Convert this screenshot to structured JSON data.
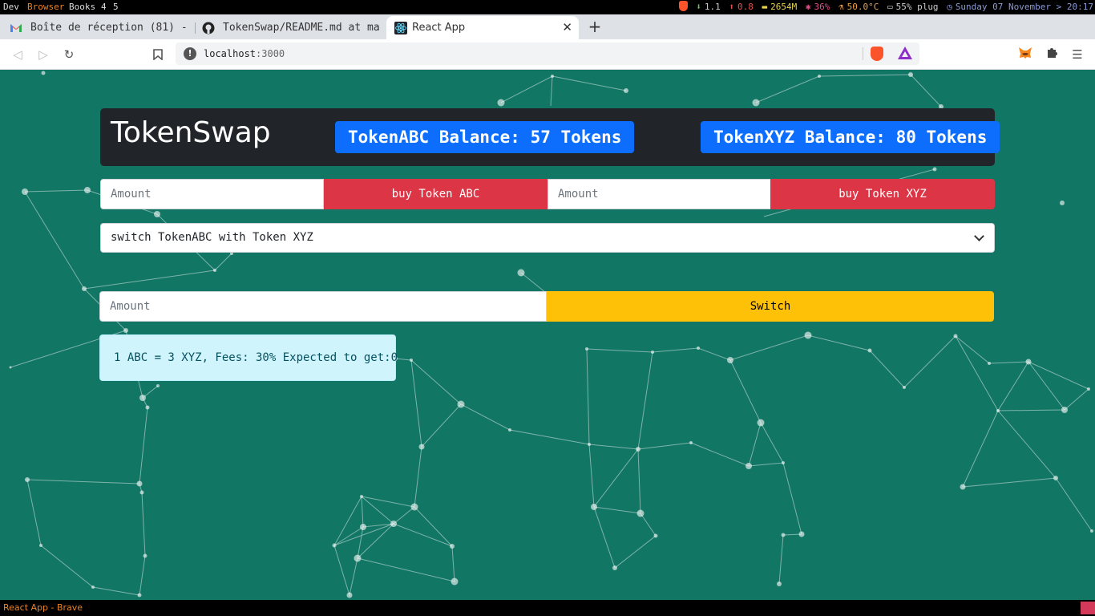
{
  "system_bar": {
    "workspaces": [
      "Dev",
      "Browser",
      "Books",
      "4",
      "5"
    ],
    "active_workspace": "Browser",
    "stats": {
      "download": "1.1",
      "upload": "0.8",
      "memory": "2654M",
      "cpu": "36%",
      "temperature": "50.0°C",
      "battery": "55% plug",
      "datetime": "Sunday 07 November > 20:17"
    }
  },
  "browser": {
    "tabs": [
      {
        "title": "Boîte de réception (81) -",
        "icon": "gmail-icon",
        "active": false
      },
      {
        "title": "TokenSwap/README.md at ma",
        "icon": "github-icon",
        "active": false
      },
      {
        "title": "React App",
        "icon": "react-icon",
        "active": true
      }
    ],
    "new_tab_label": "+",
    "url_host": "localhost",
    "url_port": ":3000"
  },
  "app": {
    "title": "TokenSwap",
    "balance_abc": "TokenABC Balance: 57 Tokens",
    "balance_xyz": "TokenXYZ Balance: 80 Tokens",
    "amount_placeholder": "Amount",
    "buy_abc_label": "buy Token ABC",
    "buy_xyz_label": "buy Token XYZ",
    "switch_select_value": "switch TokenABC with Token XYZ",
    "switch_label": "Switch",
    "rate_info": "1 ABC = 3 XYZ, Fees: 30% Expected to get:0"
  },
  "colors": {
    "page_bg": "#127665",
    "primary": "#0d6efd",
    "danger": "#dc3545",
    "warning": "#ffc107",
    "info_bg": "#cff4fc"
  },
  "status_bar": {
    "window_title": "React App - Brave"
  }
}
